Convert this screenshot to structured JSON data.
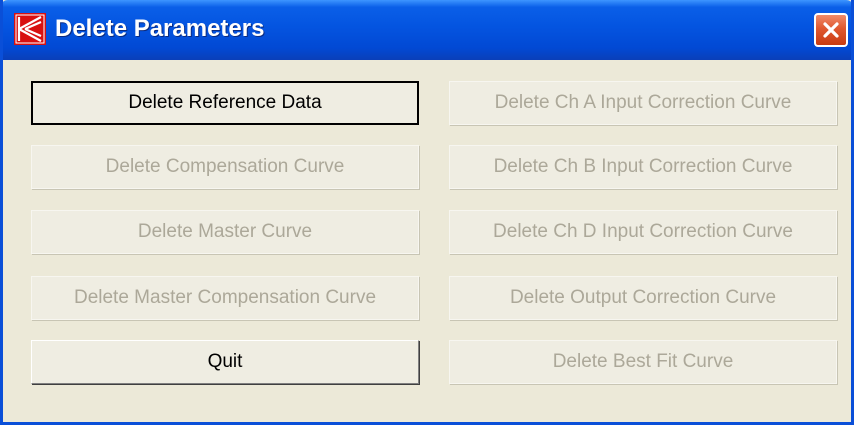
{
  "window": {
    "title": "Delete Parameters",
    "icon": "k-logo-icon",
    "colors": {
      "titlebar": "#0454e0",
      "close": "#e0582f",
      "background": "#ece9d8",
      "disabled_text": "#aca899"
    }
  },
  "buttons": {
    "delete_reference_data": {
      "label": "Delete Reference Data",
      "enabled": true,
      "default": true
    },
    "delete_compensation_curve": {
      "label": "Delete Compensation Curve",
      "enabled": false
    },
    "delete_master_curve": {
      "label": "Delete Master Curve",
      "enabled": false
    },
    "delete_master_compensation_curve": {
      "label": "Delete Master Compensation Curve",
      "enabled": false
    },
    "quit": {
      "label": "Quit",
      "enabled": true
    },
    "delete_ch_a_input_correction_curve": {
      "label": "Delete Ch A Input Correction Curve",
      "enabled": false
    },
    "delete_ch_b_input_correction_curve": {
      "label": "Delete Ch B Input Correction Curve",
      "enabled": false
    },
    "delete_ch_d_input_correction_curve": {
      "label": "Delete Ch D Input Correction Curve",
      "enabled": false
    },
    "delete_output_correction_curve": {
      "label": "Delete Output Correction Curve",
      "enabled": false
    },
    "delete_best_fit_curve": {
      "label": "Delete Best Fit Curve",
      "enabled": false
    }
  }
}
